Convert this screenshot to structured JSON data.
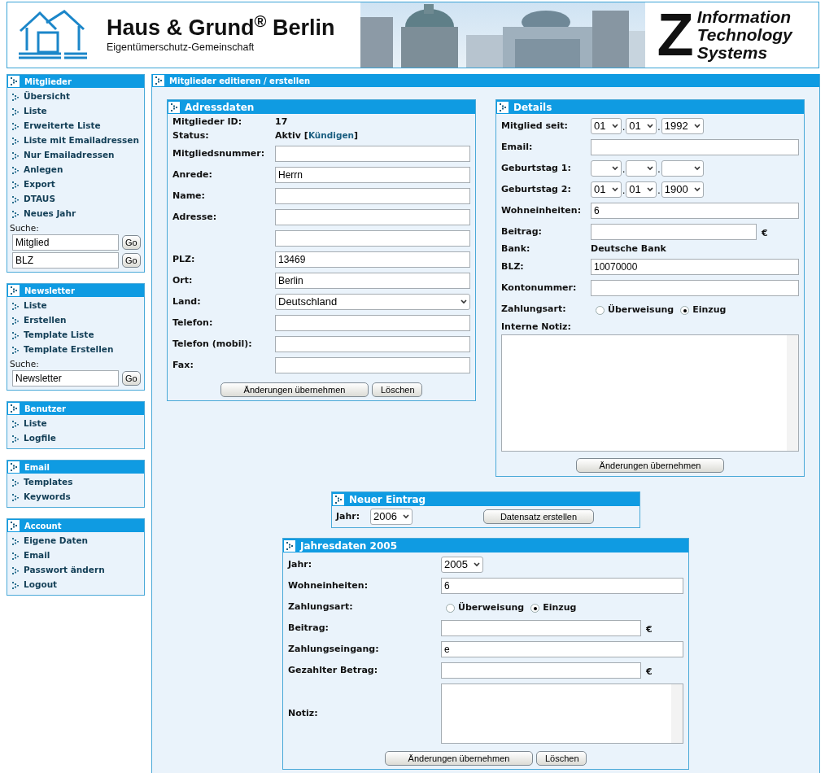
{
  "header": {
    "brand": "Haus & Grund$^{®}$ Berlin",
    "brand_subtitle": "Eigentümerschutz-Gemeinschaft",
    "partner_mark": "Z",
    "partner_lines": [
      "Information",
      "Technology",
      "Systems"
    ]
  },
  "sidebar": [
    {
      "title": "Mitglieder",
      "items": [
        "Übersicht",
        "Liste",
        "Erweiterte Liste",
        "Liste mit Emailadressen",
        "Nur Emailadressen",
        "Anlegen",
        "Export",
        "DTAUS",
        "Neues Jahr"
      ],
      "search": {
        "label": "Suche:",
        "fields": [
          {
            "value": "Mitglied",
            "button": "Go"
          },
          {
            "value": "BLZ",
            "button": "Go"
          }
        ]
      }
    },
    {
      "title": "Newsletter",
      "items": [
        "Liste",
        "Erstellen",
        "Template Liste",
        "Template Erstellen"
      ],
      "search": {
        "label": "Suche:",
        "fields": [
          {
            "value": "Newsletter",
            "button": "Go"
          }
        ]
      }
    },
    {
      "title": "Benutzer",
      "items": [
        "Liste",
        "Logfile"
      ]
    },
    {
      "title": "Email",
      "items": [
        "Templates",
        "Keywords"
      ]
    },
    {
      "title": "Account",
      "items": [
        "Eigene Daten",
        "Email",
        "Passwort ändern",
        "Logout"
      ]
    }
  ],
  "page_title": "Mitglieder editieren / erstellen",
  "address": {
    "title": "Adressdaten",
    "rows": [
      {
        "kind": "text",
        "label": "Mitglieder ID:",
        "value": "17"
      },
      {
        "kind": "status",
        "label": "Status:",
        "value": "Aktiv",
        "bracket_open": "[",
        "link": "Kündigen",
        "bracket_close": "]"
      },
      {
        "kind": "input",
        "label": "Mitgliedsnummer:"
      },
      {
        "kind": "input",
        "label": "Anrede:",
        "value": "Herrn"
      },
      {
        "kind": "input",
        "label": "Name:"
      },
      {
        "kind": "input",
        "label": "Adresse:"
      },
      {
        "kind": "input"
      },
      {
        "kind": "input",
        "label": "PLZ:",
        "value": "13469"
      },
      {
        "kind": "input",
        "label": "Ort:",
        "value": "Berlin"
      },
      {
        "kind": "select",
        "label": "Land:",
        "value": "Deutschland"
      },
      {
        "kind": "input",
        "label": "Telefon:"
      },
      {
        "kind": "input",
        "label": "Telefon (mobil):"
      },
      {
        "kind": "input",
        "label": "Fax:"
      }
    ],
    "buttons": [
      "Änderungen übernehmen",
      "Löschen"
    ]
  },
  "details": {
    "title": "Details",
    "rows": [
      {
        "kind": "date",
        "label": "Mitglied seit:",
        "parts": [
          "01",
          "01",
          "1992"
        ],
        "separator": "."
      },
      {
        "kind": "input",
        "label": "Email:"
      },
      {
        "kind": "date",
        "label": "Geburtstag 1:",
        "separator": "."
      },
      {
        "kind": "date",
        "label": "Geburtstag 2:",
        "parts": [
          "01",
          "01",
          "1900"
        ],
        "separator": "."
      },
      {
        "kind": "input",
        "label": "Wohneinheiten:",
        "value": "6"
      },
      {
        "kind": "money",
        "label": "Beitrag:",
        "unit": "€"
      },
      {
        "kind": "text",
        "label": "Bank:",
        "value": "Deutsche Bank"
      },
      {
        "kind": "input",
        "label": "BLZ:",
        "value": "10070000"
      },
      {
        "kind": "input",
        "label": "Kontonummer:"
      },
      {
        "kind": "radio",
        "label": "Zahlungsart:",
        "options": [
          {
            "label": "Überweisung",
            "selected": false
          },
          {
            "label": "Einzug",
            "selected": true
          }
        ]
      },
      {
        "kind": "note",
        "label": "Interne Notiz:"
      }
    ],
    "buttons": [
      "Änderungen übernehmen"
    ]
  },
  "new_entry": {
    "title": "Neuer Eintrag",
    "label": "Jahr:",
    "year": "2006",
    "button": "Datensatz erstellen"
  },
  "annual": {
    "title": "Jahresdaten 2005",
    "rows": [
      {
        "kind": "select",
        "label": "Jahr:",
        "value": "2005"
      },
      {
        "kind": "input",
        "label": "Wohneinheiten:",
        "value": "6"
      },
      {
        "kind": "radio",
        "label": "Zahlungsart:",
        "options": [
          {
            "label": "Überweisung",
            "selected": false
          },
          {
            "label": "Einzug",
            "selected": true
          }
        ]
      },
      {
        "kind": "money",
        "label": "Beitrag:",
        "unit": "€"
      },
      {
        "kind": "input",
        "label": "Zahlungseingang:",
        "value": "e"
      },
      {
        "kind": "money",
        "label": "Gezahlter Betrag:",
        "unit": "€"
      },
      {
        "kind": "textarea",
        "label": "Notiz:"
      }
    ],
    "buttons": [
      "Änderungen übernehmen",
      "Löschen"
    ]
  }
}
